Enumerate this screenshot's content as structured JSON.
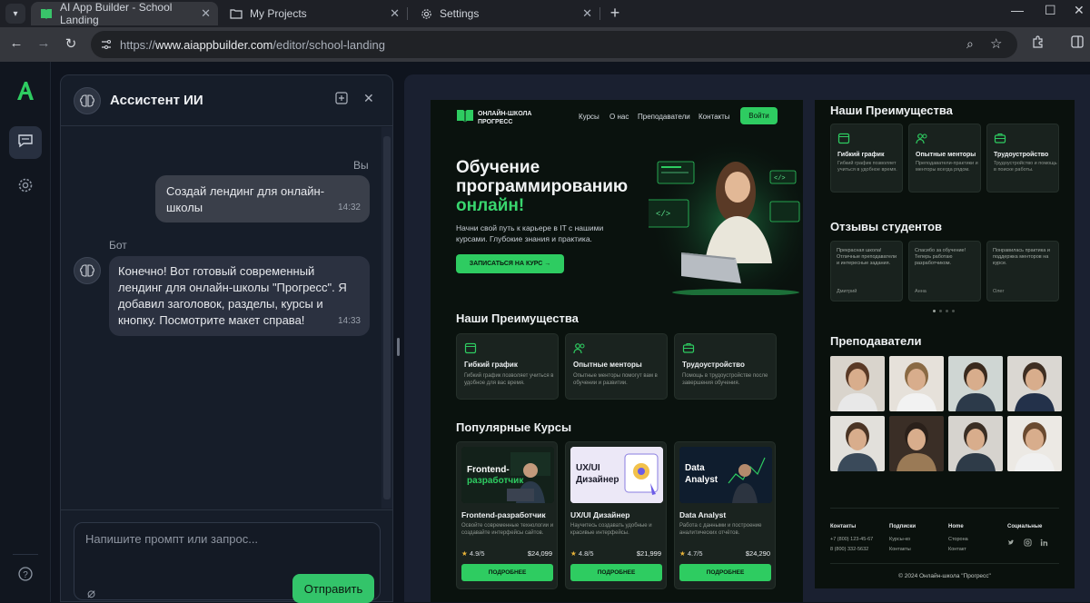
{
  "browser": {
    "tabs": [
      {
        "label": "AI App Builder - School Landing",
        "active": true
      },
      {
        "label": "My Projects",
        "active": false
      },
      {
        "label": "Settings",
        "active": false
      }
    ],
    "url_prefix": "https://",
    "url_domain": "www.aiappbuilder.com",
    "url_path": "/editor/school-landing"
  },
  "chat": {
    "title": "Ассистент ИИ",
    "you_label": "Вы",
    "bot_label": "Бот",
    "messages": [
      {
        "from": "user",
        "text": "Создай лендинг для онлайн-школы",
        "time": "14:32"
      },
      {
        "from": "bot",
        "text": "Конечно! Вот готовый современный лендинг для онлайн-школы \"Прогресс\". Я добавил заголовок, разделы, курсы и кнопку. Посмотрите макет справа!",
        "time": "14:33"
      }
    ],
    "input_placeholder": "Напишите промпт или запрос...",
    "send_label": "Отправить"
  },
  "landing": {
    "brand": "ОНЛАЙН-ШКОЛА ПРОГРЕСС",
    "nav": [
      "Курсы",
      "О нас",
      "Преподаватели",
      "Контакты"
    ],
    "login": "Войти",
    "hero_title_1": "Обучение",
    "hero_title_2": "программированию",
    "hero_title_3": "онлайн!",
    "hero_sub": "Начни свой путь к карьере в IT с нашими курсами. Глубокие знания и практика.",
    "hero_btn": "ЗАПИСАТЬСЯ НА КУРС →",
    "features_title": "Наши Преимущества",
    "features": [
      {
        "title": "Гибкий график",
        "desc": "Гибкий график позволяет учиться в удобное для вас время.",
        "icon": "calendar-icon"
      },
      {
        "title": "Опытные менторы",
        "desc": "Опытные менторы помогут вам в обучении и развитии.",
        "icon": "users-icon"
      },
      {
        "title": "Трудоустройство",
        "desc": "Помощь в трудоустройстве после завершения обучения.",
        "icon": "briefcase-icon"
      }
    ],
    "courses_title": "Популярные Курсы",
    "courses": [
      {
        "title": "Frontend-разработчик",
        "img_title_1": "Frontend-",
        "img_title_2": "разработчик",
        "desc": "Освойте современные технологии и создавайте интерфейсы сайтов.",
        "rating": "4.9/5",
        "price": "$24,099",
        "btn": "ПОДРОБНЕЕ"
      },
      {
        "title": "UX/UI Дизайнер",
        "img_title_1": "UX/UI",
        "img_title_2": "Дизайнер",
        "desc": "Научитесь создавать удобные и красивые интерфейсы.",
        "rating": "4.8/5",
        "price": "$21,999",
        "btn": "ПОДРОБНЕЕ"
      },
      {
        "title": "Data Analyst",
        "img_title_1": "Data",
        "img_title_2": "Analyst",
        "desc": "Работа с данными и построение аналитических отчётов.",
        "rating": "4.7/5",
        "price": "$24,290",
        "btn": "ПОДРОБНЕЕ"
      }
    ]
  },
  "landing_right": {
    "features_title": "Наши Преимущества",
    "features": [
      {
        "title": "Гибкий график",
        "desc": "Гибкий график позволяет учиться в удобное время."
      },
      {
        "title": "Опытные менторы",
        "desc": "Преподаватели-практики и менторы всегда рядом."
      },
      {
        "title": "Трудоустройство",
        "desc": "Трудоустройство и помощь в поиске работы."
      }
    ],
    "reviews_title": "Отзывы студентов",
    "reviews": [
      {
        "text": "Прекрасная школа! Отличные преподаватели и интересные задания.",
        "author": "Дмитрий"
      },
      {
        "text": "Спасибо за обучение! Теперь работаю разработчиком.",
        "author": "Анна"
      },
      {
        "text": "Понравилась практика и поддержка менторов на курсе.",
        "author": "Олег"
      }
    ],
    "teachers_title": "Преподаватели",
    "footer": [
      {
        "head": "Контакты",
        "items": [
          "+7 (800) 123-45-67",
          "8 (800) 332-5632"
        ]
      },
      {
        "head": "Подписки",
        "items": [
          "Курсы-ко",
          "Контакты"
        ]
      },
      {
        "head": "Home",
        "items": [
          "Сторона",
          "Контакт"
        ]
      },
      {
        "head": "Социальные",
        "items": []
      }
    ],
    "copyright": "© 2024 Онлайн-школа \"Прогресс\""
  },
  "colors": {
    "accent": "#2ecc61",
    "panel": "#161d29",
    "page": "#0f141e"
  }
}
